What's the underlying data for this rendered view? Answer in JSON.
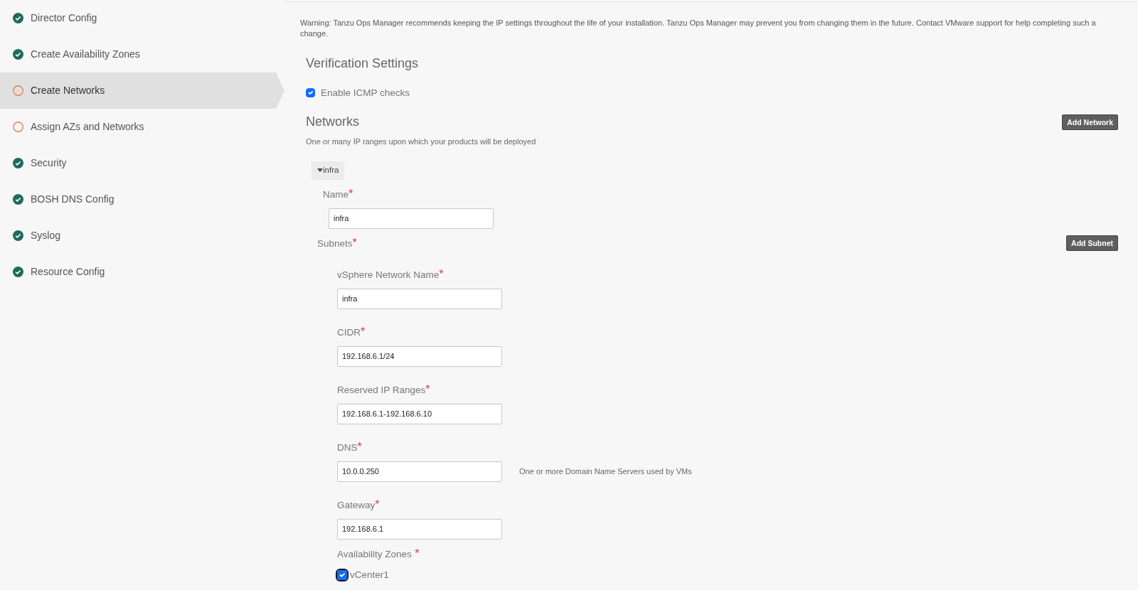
{
  "sidebar": {
    "items": [
      {
        "label": "Director Config",
        "complete": true,
        "selected": false
      },
      {
        "label": "Create Availability Zones",
        "complete": true,
        "selected": false
      },
      {
        "label": "Create Networks",
        "complete": false,
        "selected": true
      },
      {
        "label": "Assign AZs and Networks",
        "complete": false,
        "selected": false
      },
      {
        "label": "Security",
        "complete": true,
        "selected": false
      },
      {
        "label": "BOSH DNS Config",
        "complete": true,
        "selected": false
      },
      {
        "label": "Syslog",
        "complete": true,
        "selected": false
      },
      {
        "label": "Resource Config",
        "complete": true,
        "selected": false
      }
    ]
  },
  "warning": "Warning: Tanzu Ops Manager recommends keeping the IP settings throughout the life of your installation. Tanzu Ops Manager may prevent you from changing them in the future. Contact VMware support for help completing such a change.",
  "verification": {
    "title": "Verification Settings",
    "checkbox": {
      "label": "Enable ICMP checks",
      "checked": true
    }
  },
  "networks": {
    "title": "Networks",
    "add_button": "Add Network",
    "description": "One or many IP ranges upon which your products will be deployed",
    "network": {
      "toggle": "infra",
      "name_field": {
        "label": "Name",
        "required_mark": "*",
        "value": "infra"
      },
      "subnets_label": "Subnets",
      "subnets_required_mark": "*",
      "add_subnet_button": "Add Subnet",
      "subnet_fields": [
        {
          "label": "vSphere Network Name",
          "required_mark": "*",
          "value": "infra"
        },
        {
          "label": "CIDR",
          "required_mark": "*",
          "value": "192.168.6.1/24"
        },
        {
          "label": "Reserved IP Ranges",
          "required_mark": "*",
          "value": "192.168.6.1-192.168.6.10"
        },
        {
          "label": "DNS",
          "required_mark": "*",
          "value": "10.0.0.250",
          "hint": "One or more Domain Name Servers used by VMs"
        },
        {
          "label": "Gateway",
          "required_mark": "*",
          "value": "192.168.6.1"
        }
      ],
      "availability_zones": {
        "label": "Availability Zones",
        "required_mark": "*",
        "zones": [
          {
            "label": "vCenter1",
            "checked": true
          }
        ]
      }
    }
  }
}
